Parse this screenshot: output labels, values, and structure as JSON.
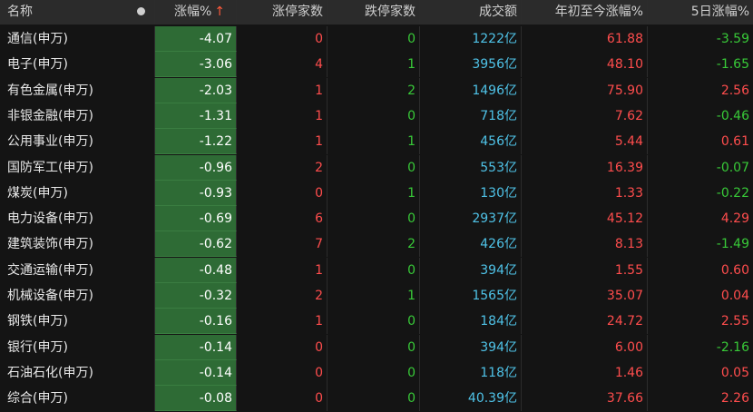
{
  "header": {
    "name": "名称",
    "change": "涨幅%",
    "sort_arrow": "↑",
    "limit_up": "涨停家数",
    "limit_down": "跌停家数",
    "volume": "成交额",
    "ytd": "年初至今涨幅%",
    "five_day": "5日涨幅%"
  },
  "rows": [
    {
      "name": "通信(申万)",
      "change": "-4.07",
      "limit_up": "0",
      "limit_down": "0",
      "volume": "1222亿",
      "ytd": "61.88",
      "five_day": "-3.59",
      "five_day_sign": "neg"
    },
    {
      "name": "电子(申万)",
      "change": "-3.06",
      "limit_up": "4",
      "limit_down": "1",
      "volume": "3956亿",
      "ytd": "48.10",
      "five_day": "-1.65",
      "five_day_sign": "neg"
    },
    {
      "name": "有色金属(申万)",
      "change": "-2.03",
      "limit_up": "1",
      "limit_down": "2",
      "volume": "1496亿",
      "ytd": "75.90",
      "five_day": "2.56",
      "five_day_sign": "pos"
    },
    {
      "name": "非银金融(申万)",
      "change": "-1.31",
      "limit_up": "1",
      "limit_down": "0",
      "volume": "718亿",
      "ytd": "7.62",
      "five_day": "-0.46",
      "five_day_sign": "neg"
    },
    {
      "name": "公用事业(申万)",
      "change": "-1.22",
      "limit_up": "1",
      "limit_down": "1",
      "volume": "456亿",
      "ytd": "5.44",
      "five_day": "0.61",
      "five_day_sign": "pos"
    },
    {
      "name": "国防军工(申万)",
      "change": "-0.96",
      "limit_up": "2",
      "limit_down": "0",
      "volume": "553亿",
      "ytd": "16.39",
      "five_day": "-0.07",
      "five_day_sign": "neg"
    },
    {
      "name": "煤炭(申万)",
      "change": "-0.93",
      "limit_up": "0",
      "limit_down": "1",
      "volume": "130亿",
      "ytd": "1.33",
      "five_day": "-0.22",
      "five_day_sign": "neg"
    },
    {
      "name": "电力设备(申万)",
      "change": "-0.69",
      "limit_up": "6",
      "limit_down": "0",
      "volume": "2937亿",
      "ytd": "45.12",
      "five_day": "4.29",
      "five_day_sign": "pos"
    },
    {
      "name": "建筑装饰(申万)",
      "change": "-0.62",
      "limit_up": "7",
      "limit_down": "2",
      "volume": "426亿",
      "ytd": "8.13",
      "five_day": "-1.49",
      "five_day_sign": "neg"
    },
    {
      "name": "交通运输(申万)",
      "change": "-0.48",
      "limit_up": "1",
      "limit_down": "0",
      "volume": "394亿",
      "ytd": "1.55",
      "five_day": "0.60",
      "five_day_sign": "pos"
    },
    {
      "name": "机械设备(申万)",
      "change": "-0.32",
      "limit_up": "2",
      "limit_down": "1",
      "volume": "1565亿",
      "ytd": "35.07",
      "five_day": "0.04",
      "five_day_sign": "pos"
    },
    {
      "name": "钢铁(申万)",
      "change": "-0.16",
      "limit_up": "1",
      "limit_down": "0",
      "volume": "184亿",
      "ytd": "24.72",
      "five_day": "2.55",
      "five_day_sign": "pos"
    },
    {
      "name": "银行(申万)",
      "change": "-0.14",
      "limit_up": "0",
      "limit_down": "0",
      "volume": "394亿",
      "ytd": "6.00",
      "five_day": "-2.16",
      "five_day_sign": "neg"
    },
    {
      "name": "石油石化(申万)",
      "change": "-0.14",
      "limit_up": "0",
      "limit_down": "0",
      "volume": "118亿",
      "ytd": "1.46",
      "five_day": "0.05",
      "five_day_sign": "pos"
    },
    {
      "name": "综合(申万)",
      "change": "-0.08",
      "limit_up": "0",
      "limit_down": "0",
      "volume": "40.39亿",
      "ytd": "37.66",
      "five_day": "2.26",
      "five_day_sign": "pos"
    }
  ],
  "colors": {
    "background": "#141414",
    "header_bg": "#2b2b2b",
    "change_cell_bg": "#2e6b35",
    "up_red": "#ff4d4d",
    "down_green": "#38c938",
    "volume_cyan": "#4fc3e8",
    "sort_arrow": "#ff5a3c"
  }
}
